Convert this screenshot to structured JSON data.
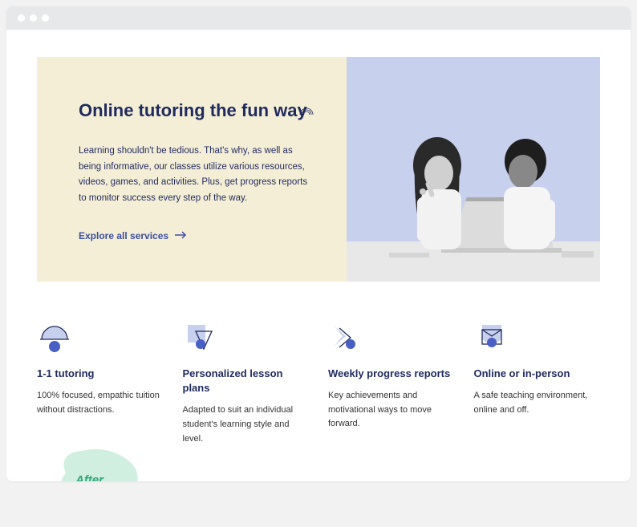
{
  "hero": {
    "title": "Online tutoring the fun way",
    "description": "Learning shouldn't be tedious. That's why, as well as being informative, our classes utilize various resources, videos, games, and activities. Plus, get progress reports to monitor success every step of the way.",
    "cta_label": "Explore all services"
  },
  "features": [
    {
      "title": "1-1 tutoring",
      "description": "100% focused, empathic tuition without distractions."
    },
    {
      "title": "Personalized lesson plans",
      "description": "Adapted to suit an individual student's learning style and level."
    },
    {
      "title": "Weekly progress reports",
      "description": "Key achievements and motivational ways to move forward."
    },
    {
      "title": "Online or in-person",
      "description": "A safe teaching environment, online and off."
    }
  ],
  "badge": {
    "label": "After"
  },
  "colors": {
    "primary": "#1f2a5e",
    "accent_light": "#c7d0ed",
    "accent_dot": "#4a5fc4",
    "cream": "#f4eed6",
    "badge_green": "#2ea678",
    "badge_bg": "#d1efe1"
  }
}
